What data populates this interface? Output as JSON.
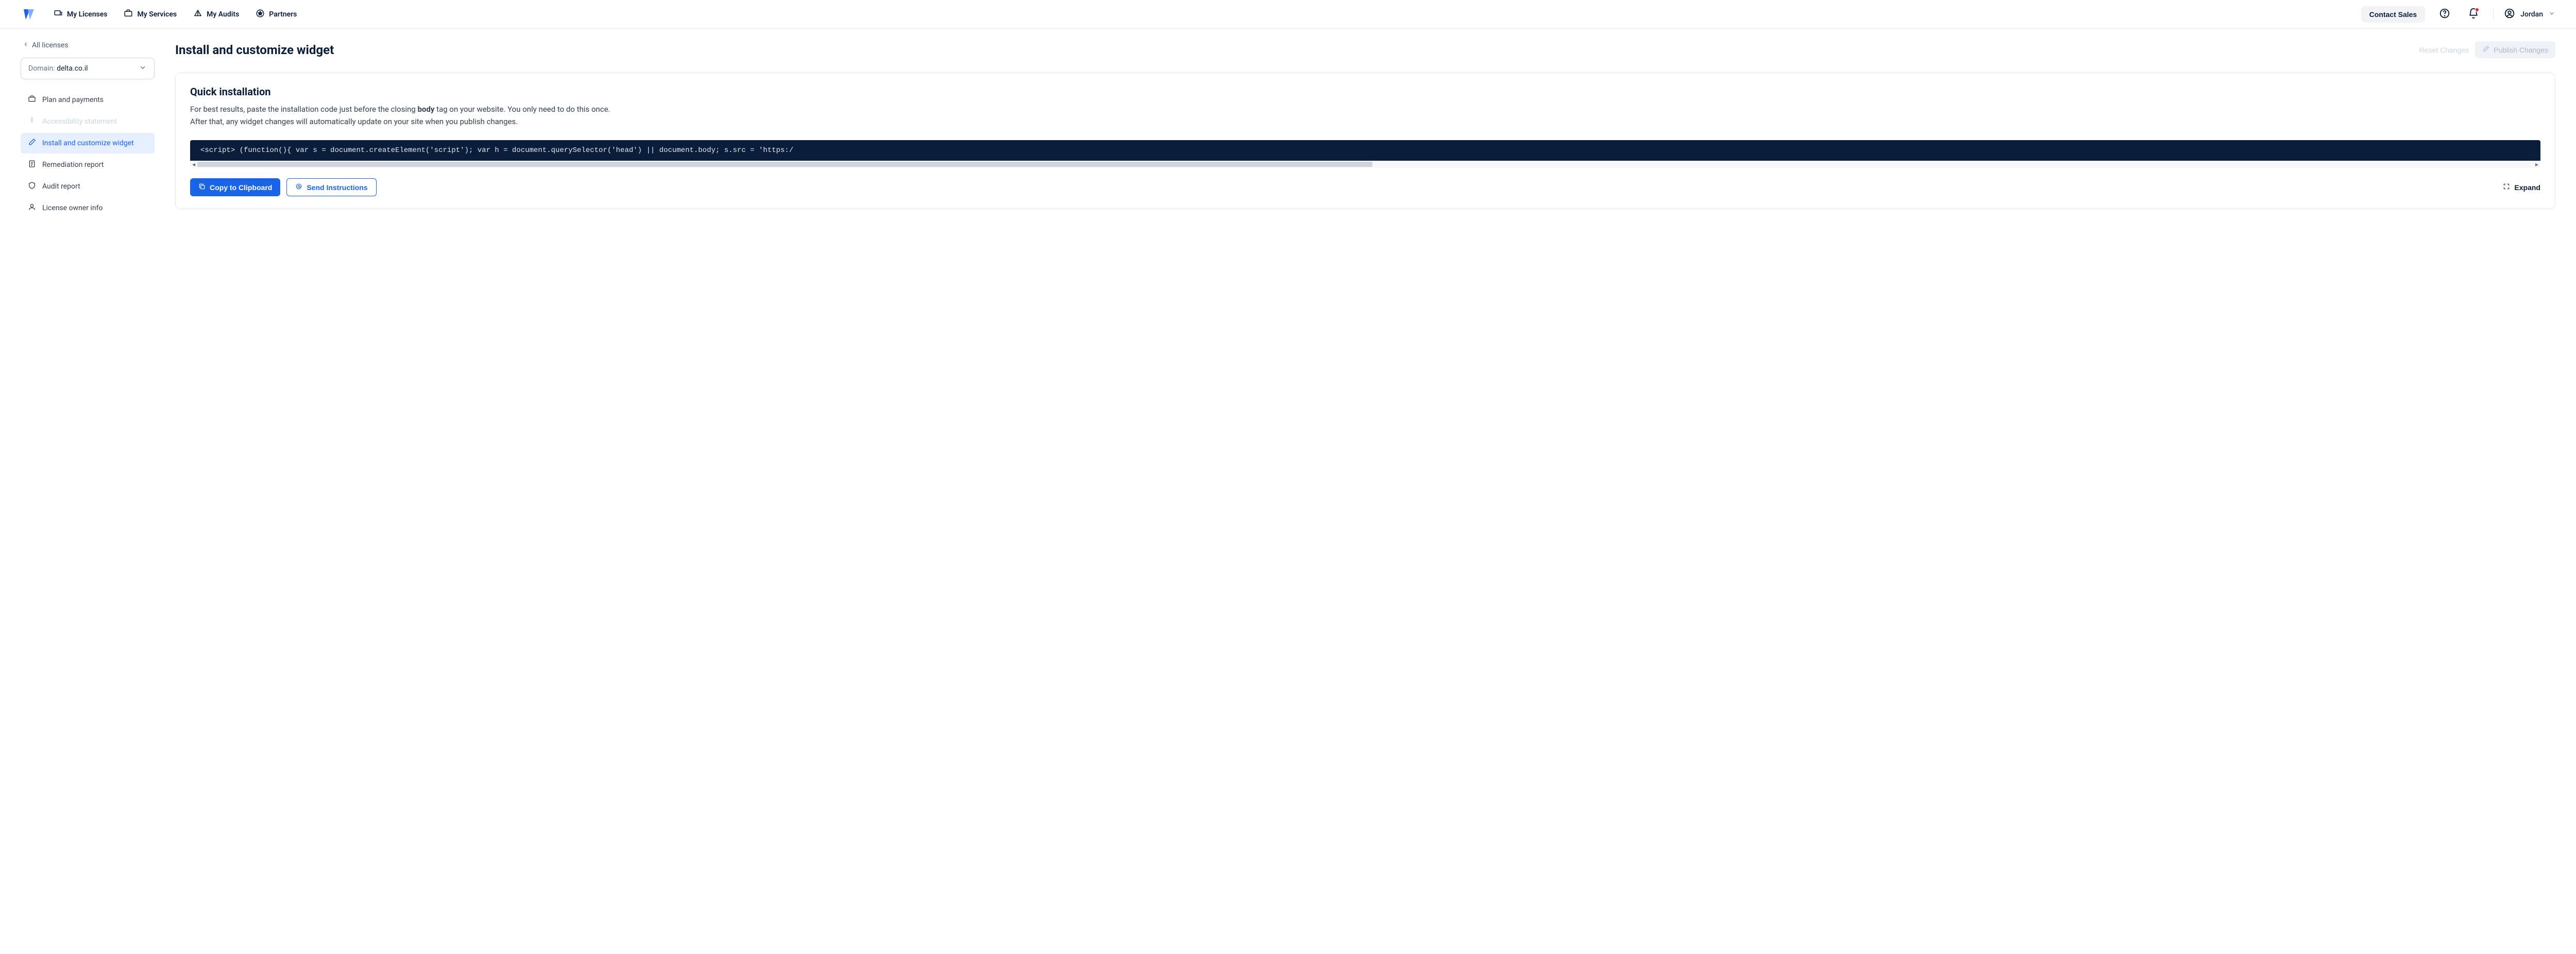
{
  "header": {
    "nav": {
      "licenses": "My Licenses",
      "services": "My Services",
      "audits": "My Audits",
      "partners": "Partners"
    },
    "contact_sales": "Contact Sales",
    "user_name": "Jordan"
  },
  "sidebar": {
    "back": "All licenses",
    "domain_label": "Domain:",
    "domain_value": "delta.co.il",
    "items": {
      "plan": "Plan and payments",
      "statement": "Accessibility statement",
      "widget": "Install and customize widget",
      "remediation": "Remediation report",
      "audit": "Audit report",
      "owner": "License owner info"
    }
  },
  "content": {
    "title": "Install and customize widget",
    "reset": "Reset Changes",
    "publish": "Publish Changes",
    "card": {
      "title": "Quick installation",
      "desc_part1": "For best results, paste the installation code just before the closing ",
      "desc_bold": "body",
      "desc_part2": " tag on your website. You only need to do this once.",
      "desc_line2": "After that, any widget changes will automatically update on your site when you publish changes.",
      "code": "<script> (function(){ var s = document.createElement('script'); var h = document.querySelector('head') || document.body; s.src = 'https:/",
      "copy": "Copy to Clipboard",
      "send": "Send Instructions",
      "expand": "Expand"
    }
  }
}
